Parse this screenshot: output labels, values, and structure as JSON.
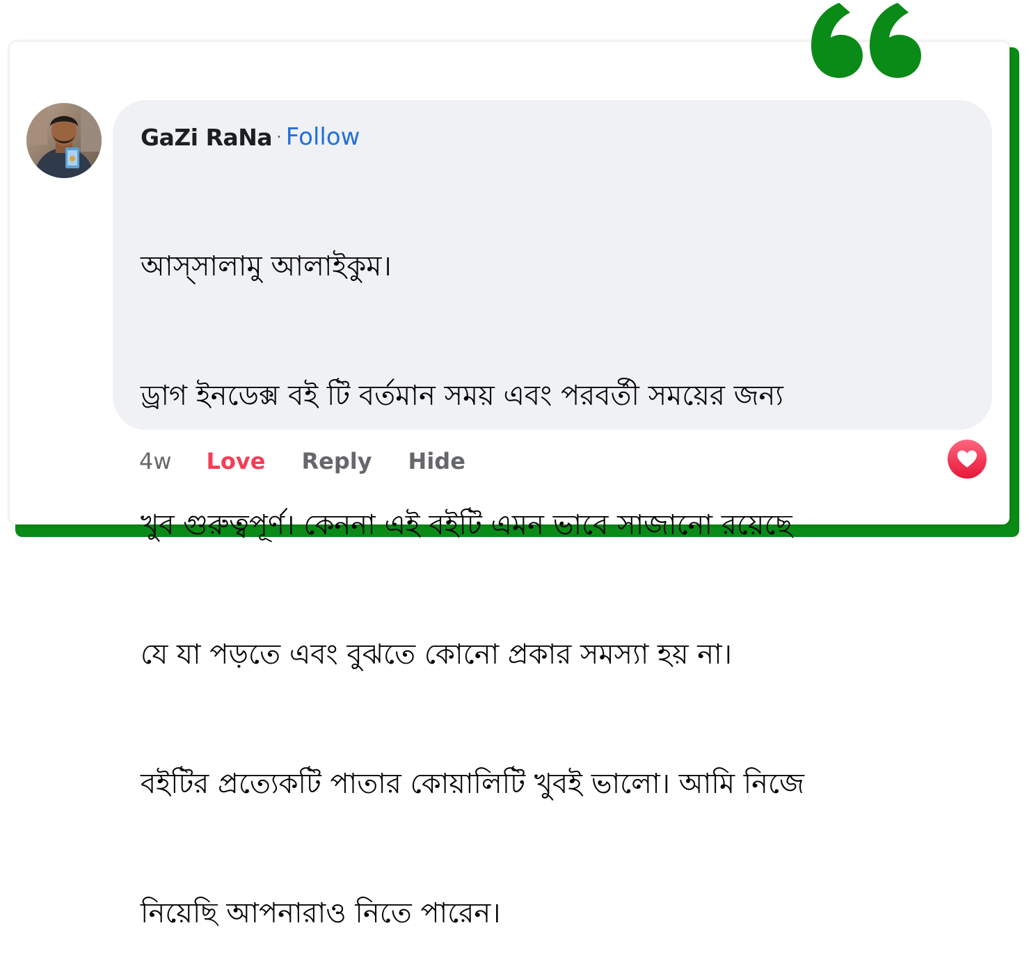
{
  "comment": {
    "author": "GaZi RaNa",
    "separator": "·",
    "follow_label": "Follow",
    "lines": [
      "আস্‌সালামু আলাইকুম।",
      "ড্রাগ ইনডেক্স বই টি বর্তমান সময় এবং পরবর্তী সময়ের জন্য",
      "খুব গুরুত্বপূর্ণ। কেননা এই বইটি এমন ভাবে সাজানো রয়েছে",
      "যে যা পড়তে এবং বুঝতে কোনো প্রকার সমস্যা হয় না।",
      "বইটির প্রত্যেকটি পাতার কোয়ালিটি খুবই ভালো। আমি নিজে",
      "নিয়েছি আপনারাও নিতে পারেন।"
    ],
    "time": "4w",
    "love_label": "Love",
    "reply_label": "Reply",
    "hide_label": "Hide"
  },
  "icons": {
    "quote": "quote-mark-icon",
    "reaction": "heart-reaction-icon",
    "avatar": "avatar"
  },
  "colors": {
    "accent_green": "#0a8a16",
    "follow_blue": "#216fdb",
    "love_red": "#f33e58",
    "bubble_bg": "#eff1f4",
    "muted_text": "#65676b"
  }
}
